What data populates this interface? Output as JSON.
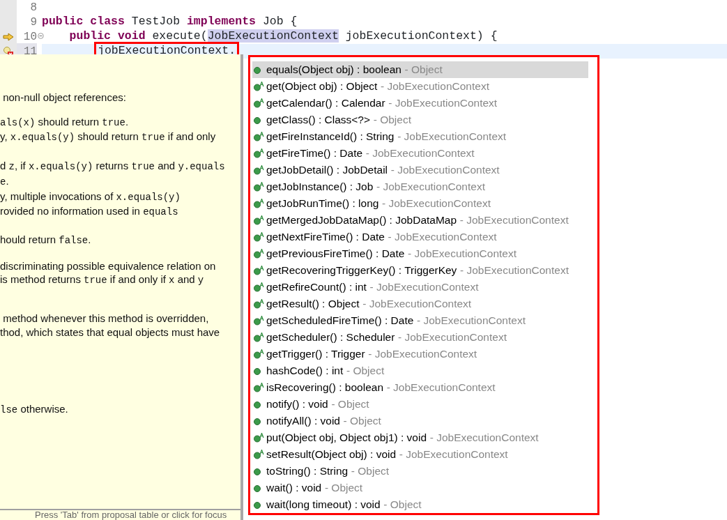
{
  "editor": {
    "lines": [
      {
        "number": "8",
        "kind": "plain",
        "current": false,
        "fold": false
      },
      {
        "number": "9",
        "kind": "plain",
        "current": false,
        "fold": false,
        "tokens": [
          {
            "kind": "keyword",
            "text": "public"
          },
          {
            "kind": "keyword",
            "text": " class"
          },
          {
            "kind": "plain",
            "text": " TestJob "
          },
          {
            "kind": "keyword",
            "text": "implements"
          },
          {
            "kind": "plain",
            "text": " Job {"
          }
        ]
      },
      {
        "number": "10",
        "current": false,
        "kind": "override",
        "fold": true,
        "tokens": [
          {
            "kind": "keyword",
            "text": "    public"
          },
          {
            "kind": "keyword",
            "text": " void"
          },
          {
            "kind": "plain",
            "text": " execute("
          },
          {
            "kind": "selected",
            "text": "JobExecutionContext"
          },
          {
            "kind": "plain",
            "text": " jobExecutionContext) {"
          }
        ]
      },
      {
        "number": "11",
        "current": true,
        "kind": "error",
        "fold": false,
        "tokens": [
          {
            "kind": "error",
            "text": "jobExecutionContext."
          }
        ]
      }
    ]
  },
  "javadoc": {
    "paragraphs": [
      [
        [
          {
            "t": " non-null object references:"
          }
        ]
      ],
      [
        [
          {
            "t": "als(x)",
            "code": true
          },
          {
            "t": " should return "
          },
          {
            "t": "true",
            "code": true
          },
          {
            "t": "."
          }
        ],
        [
          {
            "t": "y, "
          },
          {
            "t": "x.equals(y)",
            "code": true
          },
          {
            "t": " should return "
          },
          {
            "t": "true",
            "code": true
          },
          {
            "t": " if and only"
          }
        ]
      ],
      [
        [
          {
            "t": "d "
          },
          {
            "t": "z",
            "code": true
          },
          {
            "t": ", if "
          },
          {
            "t": "x.equals(y)",
            "code": true
          },
          {
            "t": " returns "
          },
          {
            "t": "true",
            "code": true
          },
          {
            "t": " and "
          },
          {
            "t": "y.equals",
            "code": true
          }
        ],
        [
          {
            "t": "e",
            "code": true
          },
          {
            "t": "."
          }
        ],
        [
          {
            "t": "y, multiple invocations of "
          },
          {
            "t": "x.equals(y)",
            "code": true
          }
        ],
        [
          {
            "t": "rovided no information used in "
          },
          {
            "t": "equals",
            "code": true
          }
        ]
      ],
      [
        [
          {
            "t": "hould return "
          },
          {
            "t": "false",
            "code": true
          },
          {
            "t": "."
          }
        ]
      ],
      [
        [
          {
            "t": "discriminating possible equivalence relation on"
          }
        ],
        [
          {
            "t": "is method returns "
          },
          {
            "t": "true",
            "code": true
          },
          {
            "t": " if and only if "
          },
          {
            "t": "x",
            "code": true
          },
          {
            "t": " and "
          },
          {
            "t": "y",
            "code": true
          }
        ]
      ],
      [
        [
          {
            "t": " method whenever this method is overridden,"
          }
        ],
        [
          {
            "t": "thod, which states that equal objects must have"
          }
        ]
      ],
      [
        [
          {
            "t": "lse",
            "code": true
          },
          {
            "t": " otherwise."
          }
        ]
      ]
    ],
    "footer": "Press 'Tab' from proposal table or click for focus"
  },
  "proposals": [
    {
      "name": "equals(Object obj) : boolean",
      "owner": "- Object",
      "kind": "method",
      "selected": true
    },
    {
      "name": "get(Object obj) : Object",
      "owner": "- JobExecutionContext",
      "kind": "abstract",
      "selected": false
    },
    {
      "name": "getCalendar() : Calendar",
      "owner": "- JobExecutionContext",
      "kind": "abstract",
      "selected": false
    },
    {
      "name": "getClass() : Class<?>",
      "owner": "- Object",
      "kind": "method",
      "selected": false
    },
    {
      "name": "getFireInstanceId() : String",
      "owner": "- JobExecutionContext",
      "kind": "abstract",
      "selected": false
    },
    {
      "name": "getFireTime() : Date",
      "owner": "- JobExecutionContext",
      "kind": "abstract",
      "selected": false
    },
    {
      "name": "getJobDetail() : JobDetail",
      "owner": "- JobExecutionContext",
      "kind": "abstract",
      "selected": false
    },
    {
      "name": "getJobInstance() : Job",
      "owner": "- JobExecutionContext",
      "kind": "abstract",
      "selected": false
    },
    {
      "name": "getJobRunTime() : long",
      "owner": "- JobExecutionContext",
      "kind": "abstract",
      "selected": false
    },
    {
      "name": "getMergedJobDataMap() : JobDataMap",
      "owner": "- JobExecutionContext",
      "kind": "abstract",
      "selected": false
    },
    {
      "name": "getNextFireTime() : Date",
      "owner": "- JobExecutionContext",
      "kind": "abstract",
      "selected": false
    },
    {
      "name": "getPreviousFireTime() : Date",
      "owner": "- JobExecutionContext",
      "kind": "abstract",
      "selected": false
    },
    {
      "name": "getRecoveringTriggerKey() : TriggerKey",
      "owner": "- JobExecutionContext",
      "kind": "abstract",
      "selected": false
    },
    {
      "name": "getRefireCount() : int",
      "owner": "- JobExecutionContext",
      "kind": "abstract",
      "selected": false
    },
    {
      "name": "getResult() : Object",
      "owner": "- JobExecutionContext",
      "kind": "abstract",
      "selected": false
    },
    {
      "name": "getScheduledFireTime() : Date",
      "owner": "- JobExecutionContext",
      "kind": "abstract",
      "selected": false
    },
    {
      "name": "getScheduler() : Scheduler",
      "owner": "- JobExecutionContext",
      "kind": "abstract",
      "selected": false
    },
    {
      "name": "getTrigger() : Trigger",
      "owner": "- JobExecutionContext",
      "kind": "abstract",
      "selected": false
    },
    {
      "name": "hashCode() : int",
      "owner": "- Object",
      "kind": "method",
      "selected": false
    },
    {
      "name": "isRecovering() : boolean",
      "owner": "- JobExecutionContext",
      "kind": "abstract",
      "selected": false
    },
    {
      "name": "notify() : void",
      "owner": "- Object",
      "kind": "method",
      "selected": false
    },
    {
      "name": "notifyAll() : void",
      "owner": "- Object",
      "kind": "method",
      "selected": false
    },
    {
      "name": "put(Object obj, Object obj1) : void",
      "owner": "- JobExecutionContext",
      "kind": "abstract",
      "selected": false
    },
    {
      "name": "setResult(Object obj) : void",
      "owner": "- JobExecutionContext",
      "kind": "abstract",
      "selected": false
    },
    {
      "name": "toString() : String",
      "owner": "- Object",
      "kind": "method",
      "selected": false
    },
    {
      "name": "wait() : void",
      "owner": "- Object",
      "kind": "method",
      "selected": false
    },
    {
      "name": "wait(long timeout) : void",
      "owner": "- Object",
      "kind": "method",
      "selected": false
    }
  ]
}
